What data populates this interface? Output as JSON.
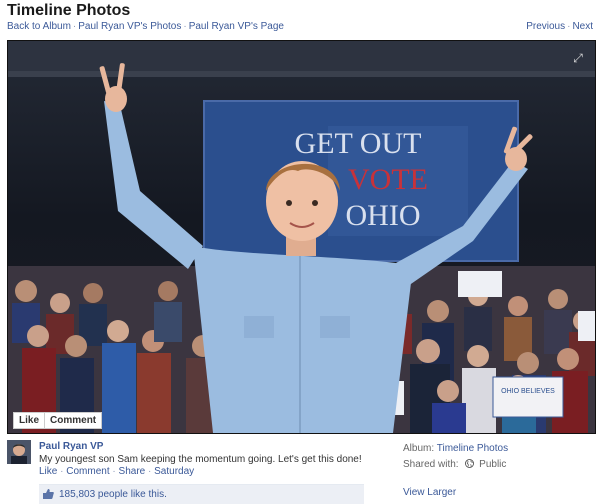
{
  "header": {
    "title": "Timeline Photos",
    "breadcrumb": {
      "back": "Back to Album",
      "photos": "Paul Ryan VP's Photos",
      "page": "Paul Ryan VP's Page",
      "separator": "·"
    },
    "pager": {
      "previous": "Previous",
      "next": "Next",
      "separator": "·"
    }
  },
  "photo": {
    "sign_text_line1": "GET OUT",
    "sign_text_line2": "VOTE",
    "sign_text_line3": "OHIO",
    "crowd_sign": "OHIO BELIEVES",
    "actions": {
      "like": "Like",
      "comment": "Comment"
    }
  },
  "post": {
    "poster": "Paul Ryan VP",
    "caption": "My youngest son Sam keeping the momentum going. Let's get this done!",
    "meta": {
      "like": "Like",
      "comment": "Comment",
      "share": "Share",
      "time": "Saturday",
      "separator": "·"
    },
    "likes": "185,803 people like this."
  },
  "info": {
    "album_label": "Album:",
    "album_value": "Timeline Photos",
    "shared_label": "Shared with:",
    "shared_value": "Public",
    "view_larger": "View Larger"
  },
  "colors": {
    "link": "#3b5998",
    "sign_blue": "#2b4f8e",
    "shirt": "#9bbce0"
  }
}
